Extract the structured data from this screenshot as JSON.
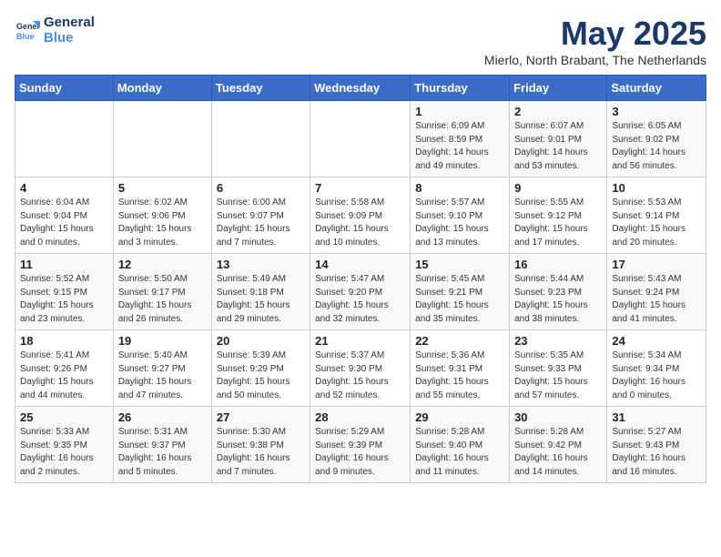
{
  "header": {
    "logo_line1": "General",
    "logo_line2": "Blue",
    "month_year": "May 2025",
    "location": "Mierlo, North Brabant, The Netherlands"
  },
  "days_of_week": [
    "Sunday",
    "Monday",
    "Tuesday",
    "Wednesday",
    "Thursday",
    "Friday",
    "Saturday"
  ],
  "weeks": [
    [
      {
        "day": "",
        "detail": ""
      },
      {
        "day": "",
        "detail": ""
      },
      {
        "day": "",
        "detail": ""
      },
      {
        "day": "",
        "detail": ""
      },
      {
        "day": "1",
        "detail": "Sunrise: 6:09 AM\nSunset: 8:59 PM\nDaylight: 14 hours\nand 49 minutes."
      },
      {
        "day": "2",
        "detail": "Sunrise: 6:07 AM\nSunset: 9:01 PM\nDaylight: 14 hours\nand 53 minutes."
      },
      {
        "day": "3",
        "detail": "Sunrise: 6:05 AM\nSunset: 9:02 PM\nDaylight: 14 hours\nand 56 minutes."
      }
    ],
    [
      {
        "day": "4",
        "detail": "Sunrise: 6:04 AM\nSunset: 9:04 PM\nDaylight: 15 hours\nand 0 minutes."
      },
      {
        "day": "5",
        "detail": "Sunrise: 6:02 AM\nSunset: 9:06 PM\nDaylight: 15 hours\nand 3 minutes."
      },
      {
        "day": "6",
        "detail": "Sunrise: 6:00 AM\nSunset: 9:07 PM\nDaylight: 15 hours\nand 7 minutes."
      },
      {
        "day": "7",
        "detail": "Sunrise: 5:58 AM\nSunset: 9:09 PM\nDaylight: 15 hours\nand 10 minutes."
      },
      {
        "day": "8",
        "detail": "Sunrise: 5:57 AM\nSunset: 9:10 PM\nDaylight: 15 hours\nand 13 minutes."
      },
      {
        "day": "9",
        "detail": "Sunrise: 5:55 AM\nSunset: 9:12 PM\nDaylight: 15 hours\nand 17 minutes."
      },
      {
        "day": "10",
        "detail": "Sunrise: 5:53 AM\nSunset: 9:14 PM\nDaylight: 15 hours\nand 20 minutes."
      }
    ],
    [
      {
        "day": "11",
        "detail": "Sunrise: 5:52 AM\nSunset: 9:15 PM\nDaylight: 15 hours\nand 23 minutes."
      },
      {
        "day": "12",
        "detail": "Sunrise: 5:50 AM\nSunset: 9:17 PM\nDaylight: 15 hours\nand 26 minutes."
      },
      {
        "day": "13",
        "detail": "Sunrise: 5:49 AM\nSunset: 9:18 PM\nDaylight: 15 hours\nand 29 minutes."
      },
      {
        "day": "14",
        "detail": "Sunrise: 5:47 AM\nSunset: 9:20 PM\nDaylight: 15 hours\nand 32 minutes."
      },
      {
        "day": "15",
        "detail": "Sunrise: 5:45 AM\nSunset: 9:21 PM\nDaylight: 15 hours\nand 35 minutes."
      },
      {
        "day": "16",
        "detail": "Sunrise: 5:44 AM\nSunset: 9:23 PM\nDaylight: 15 hours\nand 38 minutes."
      },
      {
        "day": "17",
        "detail": "Sunrise: 5:43 AM\nSunset: 9:24 PM\nDaylight: 15 hours\nand 41 minutes."
      }
    ],
    [
      {
        "day": "18",
        "detail": "Sunrise: 5:41 AM\nSunset: 9:26 PM\nDaylight: 15 hours\nand 44 minutes."
      },
      {
        "day": "19",
        "detail": "Sunrise: 5:40 AM\nSunset: 9:27 PM\nDaylight: 15 hours\nand 47 minutes."
      },
      {
        "day": "20",
        "detail": "Sunrise: 5:39 AM\nSunset: 9:29 PM\nDaylight: 15 hours\nand 50 minutes."
      },
      {
        "day": "21",
        "detail": "Sunrise: 5:37 AM\nSunset: 9:30 PM\nDaylight: 15 hours\nand 52 minutes."
      },
      {
        "day": "22",
        "detail": "Sunrise: 5:36 AM\nSunset: 9:31 PM\nDaylight: 15 hours\nand 55 minutes."
      },
      {
        "day": "23",
        "detail": "Sunrise: 5:35 AM\nSunset: 9:33 PM\nDaylight: 15 hours\nand 57 minutes."
      },
      {
        "day": "24",
        "detail": "Sunrise: 5:34 AM\nSunset: 9:34 PM\nDaylight: 16 hours\nand 0 minutes."
      }
    ],
    [
      {
        "day": "25",
        "detail": "Sunrise: 5:33 AM\nSunset: 9:35 PM\nDaylight: 16 hours\nand 2 minutes."
      },
      {
        "day": "26",
        "detail": "Sunrise: 5:31 AM\nSunset: 9:37 PM\nDaylight: 16 hours\nand 5 minutes."
      },
      {
        "day": "27",
        "detail": "Sunrise: 5:30 AM\nSunset: 9:38 PM\nDaylight: 16 hours\nand 7 minutes."
      },
      {
        "day": "28",
        "detail": "Sunrise: 5:29 AM\nSunset: 9:39 PM\nDaylight: 16 hours\nand 9 minutes."
      },
      {
        "day": "29",
        "detail": "Sunrise: 5:28 AM\nSunset: 9:40 PM\nDaylight: 16 hours\nand 11 minutes."
      },
      {
        "day": "30",
        "detail": "Sunrise: 5:28 AM\nSunset: 9:42 PM\nDaylight: 16 hours\nand 14 minutes."
      },
      {
        "day": "31",
        "detail": "Sunrise: 5:27 AM\nSunset: 9:43 PM\nDaylight: 16 hours\nand 16 minutes."
      }
    ]
  ]
}
